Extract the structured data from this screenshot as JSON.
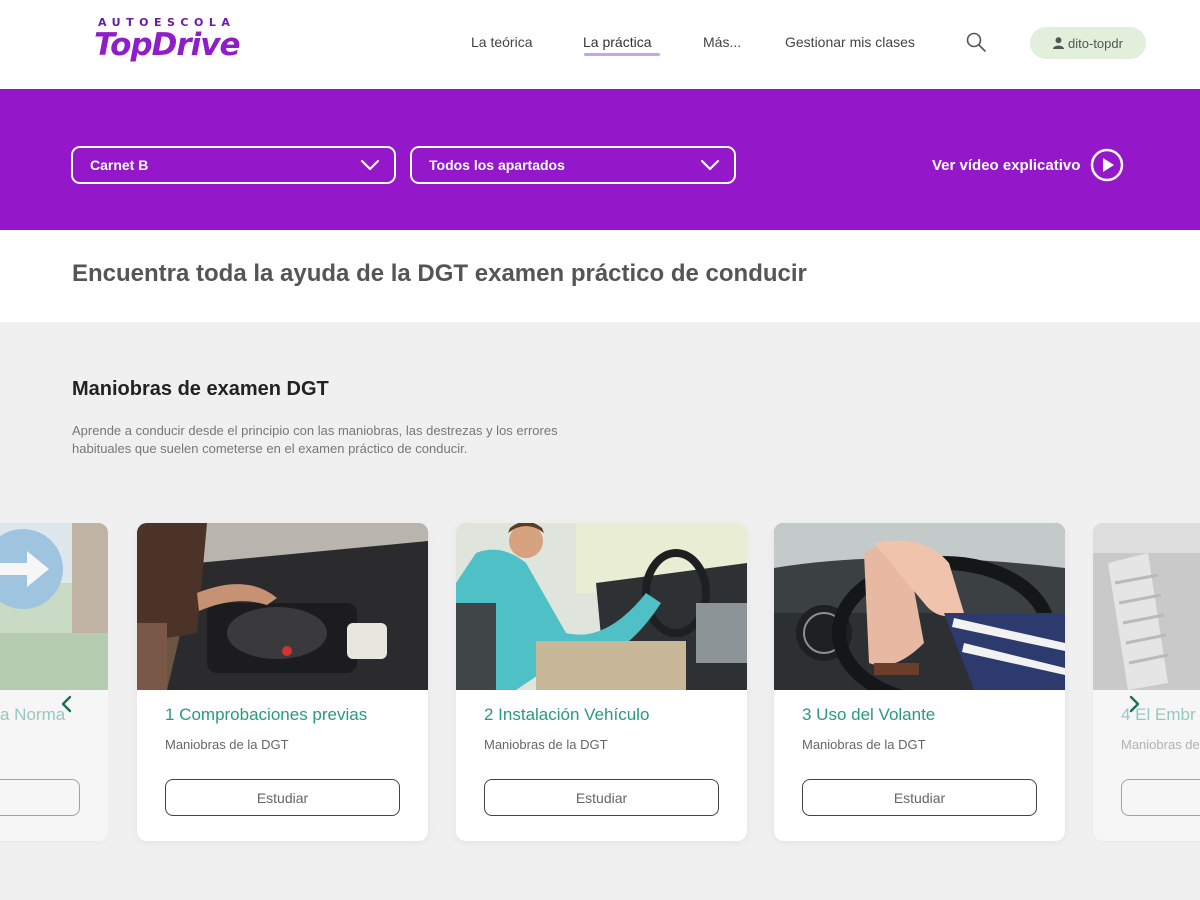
{
  "brand": {
    "top": "AUTOESCOLA",
    "main": "TopDrive",
    "color": "#8f1dc8"
  },
  "nav": {
    "items": [
      {
        "label": "La teórica"
      },
      {
        "label": "La práctica",
        "active": true
      },
      {
        "label": "Más..."
      },
      {
        "label": "Gestionar mis clases"
      }
    ],
    "search_icon": "search-icon",
    "user": {
      "icon": "user-icon",
      "name": "dito-topdr"
    }
  },
  "filters": {
    "license": "Carnet B",
    "section": "Todos los apartados",
    "video_label": "Ver vídeo explicativo",
    "band_color": "#9418c9"
  },
  "intro": {
    "heading": "Encuentra toda la ayuda de la DGT examen práctico de conducir"
  },
  "maneuvers": {
    "title": "Maniobras de examen DGT",
    "description": "Aprende a conducir desde el principio con las maniobras, las destrezas y los errores habituales que suelen cometerse en el examen práctico de conducir.",
    "cards": [
      {
        "title": "a Norma",
        "subtitle": "",
        "button": ""
      },
      {
        "title": "1 Comprobaciones previas",
        "subtitle": "Maniobras de la DGT",
        "button": "Estudiar"
      },
      {
        "title": "2 Instalación Vehículo",
        "subtitle": "Maniobras de la DGT",
        "button": "Estudiar"
      },
      {
        "title": "3 Uso del Volante",
        "subtitle": "Maniobras de la DGT",
        "button": "Estudiar"
      },
      {
        "title": "4 El Embr",
        "subtitle": "Maniobras de",
        "button": ""
      }
    ],
    "accent_color": "#2a9a7a"
  }
}
